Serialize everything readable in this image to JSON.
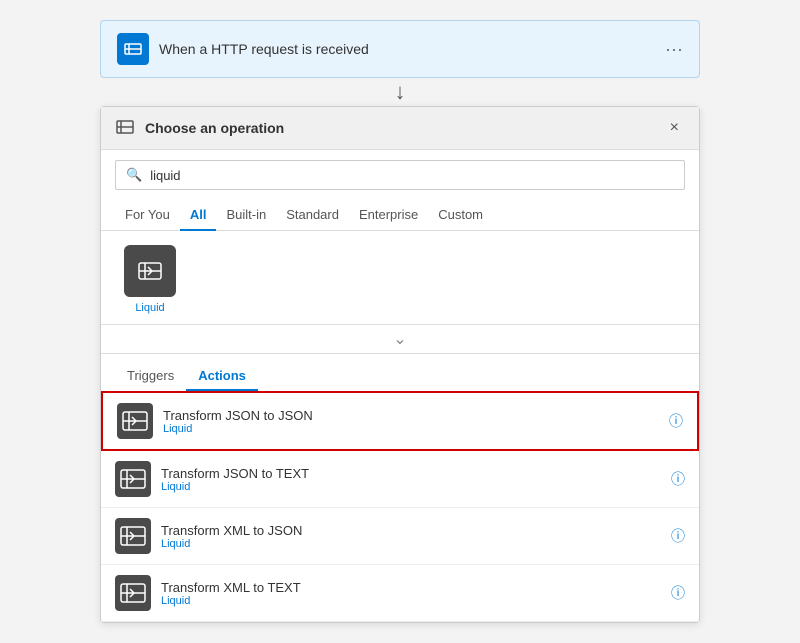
{
  "httpBlock": {
    "title": "When a HTTP request is received",
    "dots": "···"
  },
  "panel": {
    "header": "Choose an operation",
    "closeLabel": "×"
  },
  "search": {
    "value": "liquid",
    "placeholder": "Search"
  },
  "tabs": [
    {
      "id": "for-you",
      "label": "For You",
      "active": false
    },
    {
      "id": "all",
      "label": "All",
      "active": true
    },
    {
      "id": "built-in",
      "label": "Built-in",
      "active": false
    },
    {
      "id": "standard",
      "label": "Standard",
      "active": false
    },
    {
      "id": "enterprise",
      "label": "Enterprise",
      "active": false
    },
    {
      "id": "custom",
      "label": "Custom",
      "active": false
    }
  ],
  "connector": {
    "label": "Liquid"
  },
  "subTabs": [
    {
      "id": "triggers",
      "label": "Triggers",
      "active": false
    },
    {
      "id": "actions",
      "label": "Actions",
      "active": true
    }
  ],
  "actions": [
    {
      "id": 1,
      "name": "Transform JSON to JSON",
      "sub": "Liquid",
      "selected": true
    },
    {
      "id": 2,
      "name": "Transform JSON to TEXT",
      "sub": "Liquid",
      "selected": false
    },
    {
      "id": 3,
      "name": "Transform XML to JSON",
      "sub": "Liquid",
      "selected": false
    },
    {
      "id": 4,
      "name": "Transform XML to TEXT",
      "sub": "Liquid",
      "selected": false
    }
  ]
}
